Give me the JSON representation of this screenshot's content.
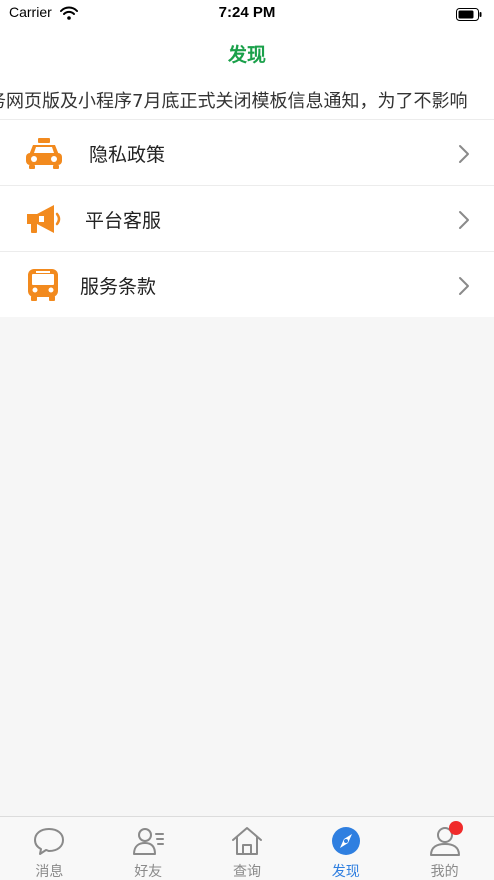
{
  "status_bar": {
    "carrier": "Carrier",
    "time": "7:24 PM"
  },
  "header": {
    "title": "发现"
  },
  "notice": {
    "text": "务网页版及小程序7月底正式关闭模板信息通知，为了不影响"
  },
  "menu": {
    "items": [
      {
        "label": "隐私政策",
        "icon": "taxi-icon"
      },
      {
        "label": "平台客服",
        "icon": "megaphone-icon"
      },
      {
        "label": "服务条款",
        "icon": "bus-icon"
      }
    ]
  },
  "tab_bar": {
    "tabs": [
      {
        "label": "消息",
        "icon": "chat-bubble-icon"
      },
      {
        "label": "好友",
        "icon": "contacts-icon"
      },
      {
        "label": "查询",
        "icon": "home-icon"
      },
      {
        "label": "发现",
        "icon": "compass-icon",
        "active": true
      },
      {
        "label": "我的",
        "icon": "profile-icon",
        "badge": true
      }
    ]
  },
  "colors": {
    "title": "#1aa04a",
    "icon_orange": "#f28a1e",
    "tab_active": "#2f7fe0",
    "badge": "#f02b2b"
  }
}
